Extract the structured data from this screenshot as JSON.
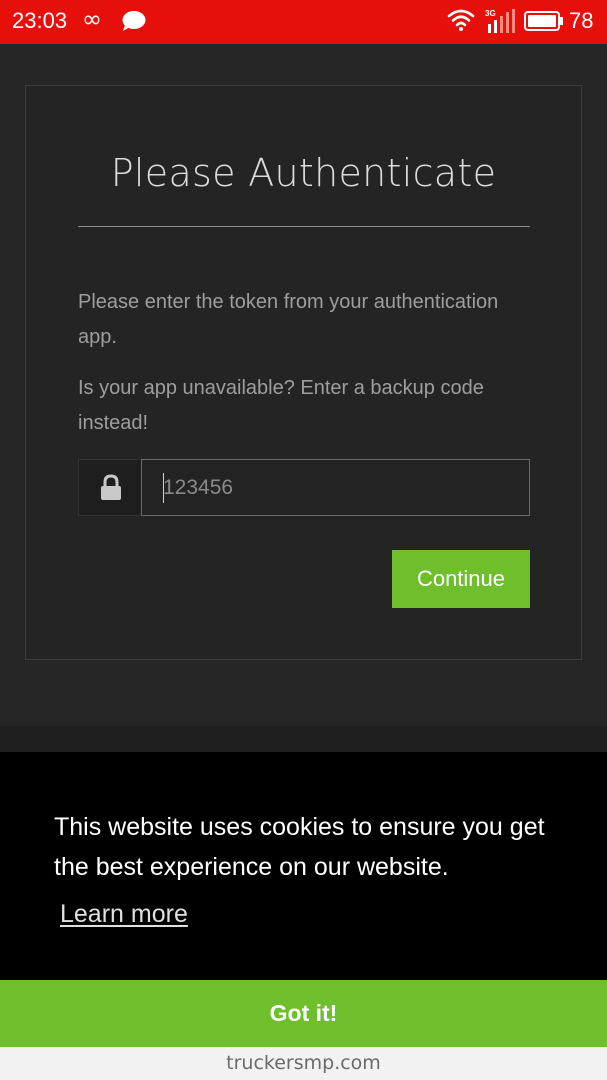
{
  "status_bar": {
    "time": "23:03",
    "infinity_symbol": "∞",
    "network_type": "3G",
    "battery_level": "78",
    "icons": [
      "infinity-icon",
      "chat-bubble-icon",
      "wifi-icon",
      "signal-icon",
      "battery-icon"
    ]
  },
  "auth": {
    "title": "Please Authenticate",
    "instructions": "Please enter the token from your authentication app.",
    "backup_hint": "Is your app unavailable? Enter a backup code instead!",
    "token_input": {
      "placeholder": "123456",
      "value": ""
    },
    "lock_icon": "lock-icon",
    "continue_label": "Continue",
    "accent_color": "#6fbe2c"
  },
  "cookie_banner": {
    "message": "This website uses cookies to ensure you get the best experience on our website.",
    "learn_more_label": "Learn more",
    "accept_label": "Got it!"
  },
  "browser": {
    "url": "truckersmp.com"
  }
}
